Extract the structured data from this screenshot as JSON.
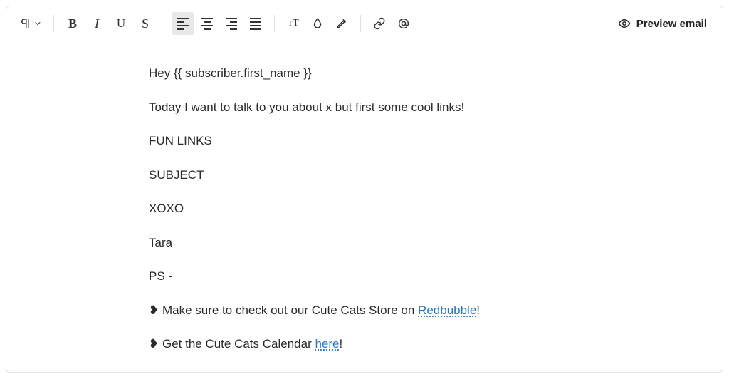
{
  "toolbar": {
    "preview_label": "Preview email"
  },
  "content": {
    "line1": "Hey {{ subscriber.first_name }}",
    "line2": "Today I want to talk to you about x but first some cool links!",
    "line3": "FUN LINKS",
    "line4": "SUBJECT",
    "line5": "XOXO",
    "line6": "Tara",
    "line7": "PS -",
    "line8_prefix": "❥ Make sure to check out our Cute Cats Store on ",
    "line8_link": "Redbubble",
    "line8_suffix": "!",
    "line9_prefix": "❥ Get the Cute Cats Calendar ",
    "line9_link": "here",
    "line9_suffix": "!"
  }
}
